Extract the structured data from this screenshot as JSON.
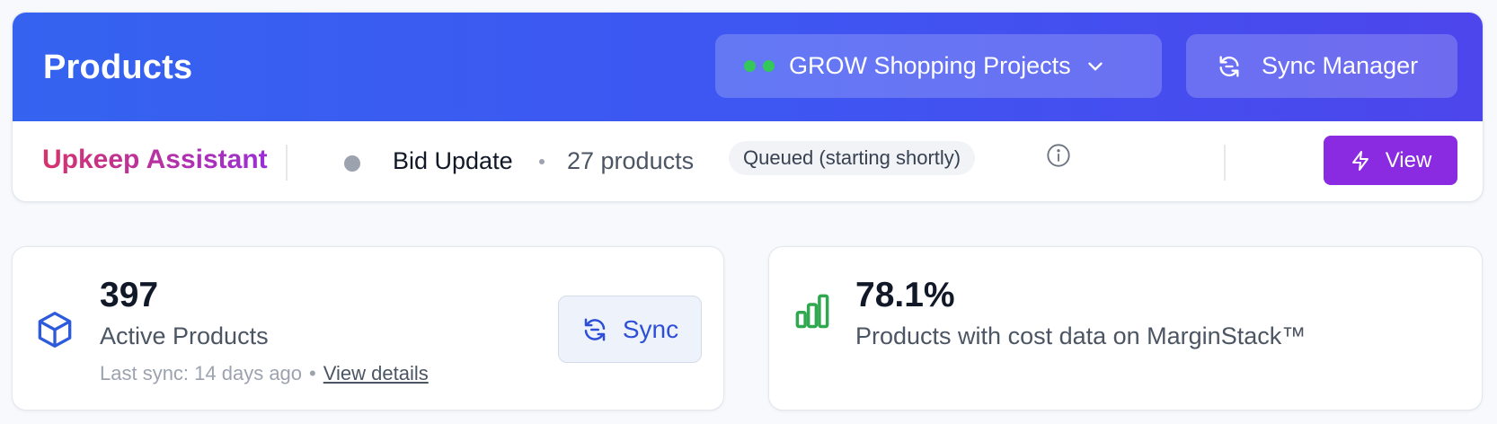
{
  "header": {
    "title": "Products",
    "project_selector": {
      "label": "GROW Shopping Projects",
      "icon": "chevron-down-icon"
    },
    "sync_manager": {
      "label": "Sync Manager",
      "icon": "refresh-icon"
    }
  },
  "assistant": {
    "title": "Upkeep Assistant",
    "task": "Bid Update",
    "products": "27 products",
    "status": "Queued (starting shortly)",
    "view_label": "View"
  },
  "stats": {
    "active": {
      "value": "397",
      "label": "Active Products",
      "last_sync": "Last sync: 14 days ago",
      "separator": "•",
      "details_link": "View details",
      "sync_label": "Sync"
    },
    "cost": {
      "value": "78.1%",
      "label": "Products with cost data on MarginStack™"
    }
  },
  "colors": {
    "banner_start": "#3563f0",
    "banner_end": "#4c46ec",
    "assistant_gradient_start": "#d6336c",
    "assistant_gradient_end": "#9a2fd6",
    "view_button": "#8a2be2",
    "status_dot_green": "#34c759",
    "chart_icon_green": "#2fa84f",
    "box_icon_blue": "#2d5bdb"
  }
}
